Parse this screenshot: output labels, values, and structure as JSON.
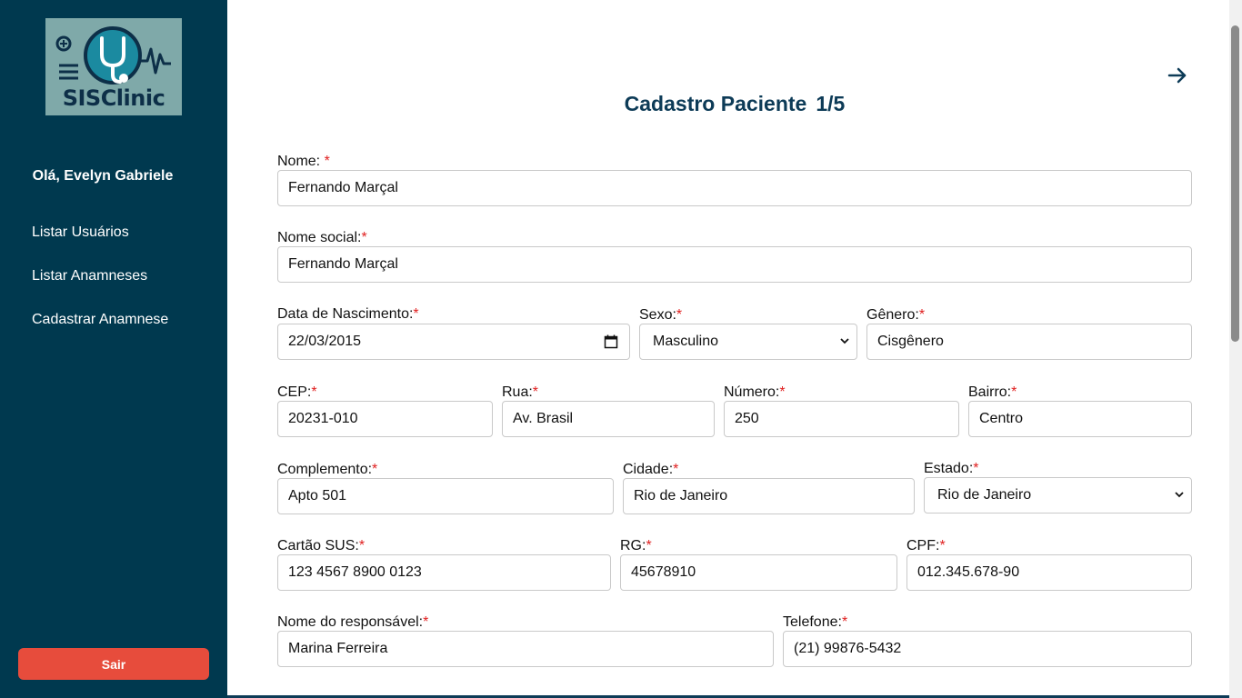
{
  "sidebar": {
    "logo_text": "SISClinic",
    "greeting": "Olá, Evelyn Gabriele",
    "nav": [
      {
        "label": "Listar Usuários",
        "icon": ""
      },
      {
        "label": "Listar Anamneses",
        "icon": ""
      },
      {
        "label": "Cadastrar Anamnese",
        "icon": ""
      }
    ],
    "logout_label": "Sair"
  },
  "header": {
    "title": "Cadastro Paciente",
    "step": "1/5",
    "next_icon": "arrow-right-icon"
  },
  "form": {
    "required_mark": "*",
    "nome": {
      "label": "Nome: ",
      "value": "Fernando Marçal"
    },
    "nome_social": {
      "label": "Nome social:",
      "value": "Fernando Marçal"
    },
    "data_nascimento": {
      "label": "Data de Nascimento:",
      "value": "22/03/2015"
    },
    "sexo": {
      "label": "Sexo:",
      "value": "Masculino"
    },
    "genero": {
      "label": "Gênero:",
      "value": "Cisgênero"
    },
    "cep": {
      "label": "CEP:",
      "value": "20231-010"
    },
    "rua": {
      "label": "Rua:",
      "value": "Av. Brasil"
    },
    "numero": {
      "label": "Número:",
      "value": "250"
    },
    "bairro": {
      "label": "Bairro:",
      "value": "Centro"
    },
    "complemento": {
      "label": "Complemento:",
      "value": "Apto 501"
    },
    "cidade": {
      "label": "Cidade:",
      "value": "Rio de Janeiro"
    },
    "estado": {
      "label": "Estado:",
      "value": "Rio de Janeiro"
    },
    "cartao_sus": {
      "label": "Cartão SUS:",
      "value": "123 4567 8900 0123"
    },
    "rg": {
      "label": "RG:",
      "value": "45678910"
    },
    "cpf": {
      "label": "CPF:",
      "value": "012.345.678-90"
    },
    "responsavel": {
      "label": "Nome do responsável:",
      "value": "Marina Ferreira"
    },
    "telefone": {
      "label": "Telefone:",
      "value": "(21) 99876-5432"
    }
  },
  "colors": {
    "sidebar_bg": "#00394f",
    "title": "#0d3b57",
    "logout_bg": "#e74c3c",
    "required": "#e02020"
  }
}
